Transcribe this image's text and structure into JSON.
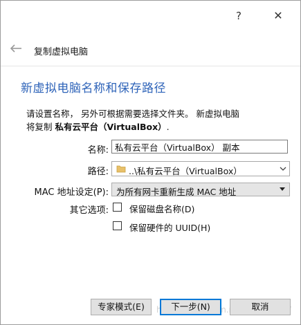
{
  "window": {
    "help_glyph": "?",
    "close_glyph": "✕",
    "wizard_title": "复制虚拟电脑"
  },
  "page": {
    "heading": "新虚拟电脑名称和保存路径",
    "description_line1": "请设置名称， 另外可根据需要选择文件夹。 新虚拟电脑",
    "description_line2_prefix": "将复制 ",
    "description_vm_name": "私有云平台（VirtualBox）",
    "description_line2_suffix": "."
  },
  "form": {
    "name_label": "名称:",
    "name_value": "私有云平台（VirtualBox） 副本",
    "path_label": "路径:",
    "path_value": "..\\私有云平台（VirtualBox）",
    "mac_label": "MAC 地址设定(P):",
    "mac_value": "为所有网卡重新生成 MAC 地址",
    "other_label": "其它选项:",
    "keep_disk_names_label": "保留磁盘名称(D)",
    "keep_disk_names_checked": false,
    "keep_hw_uuid_label": "保留硬件的 UUID(H)",
    "keep_hw_uuid_checked": false
  },
  "buttons": {
    "expert_mode": "专家模式(E)",
    "next": "下一步(N)",
    "cancel": "取消"
  },
  "watermark": "https://blog.csdn.net/weixin_297",
  "icons": {
    "back": "back-arrow-icon",
    "folder": "folder-icon",
    "chevron": "chevron-down-icon"
  },
  "colors": {
    "heading": "#2f64b9",
    "default_button_border": "#0078d7",
    "folder": "#e8c069"
  }
}
